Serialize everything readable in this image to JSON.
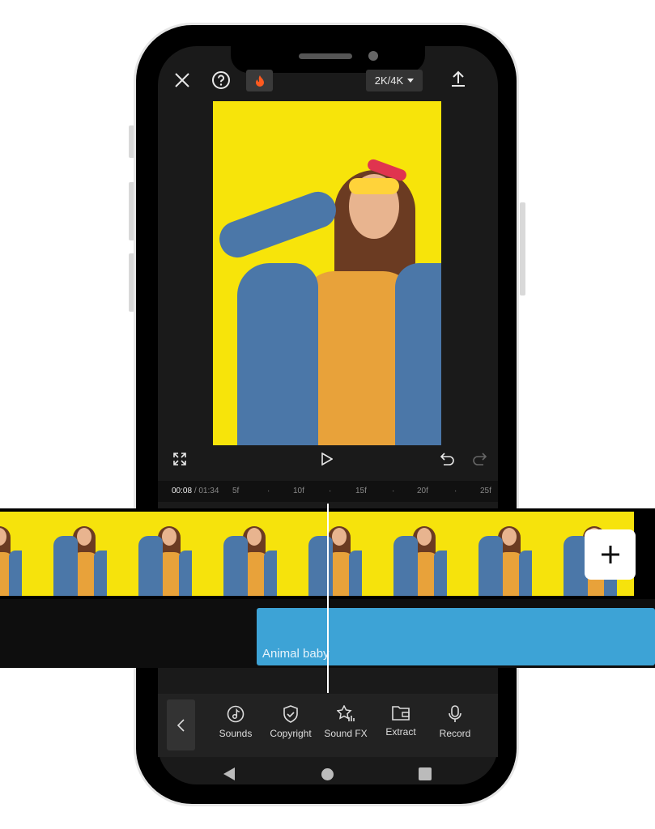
{
  "top_bar": {
    "quality_label": "2K/4K",
    "icons": [
      "close-icon",
      "help-icon",
      "fire-icon",
      "chevron-down-icon",
      "upload-icon"
    ]
  },
  "preview_controls": {
    "icons": [
      "fullscreen-icon",
      "play-icon",
      "undo-icon",
      "redo-icon"
    ]
  },
  "ruler": {
    "current_time": "00:08",
    "separator": "/",
    "total_time": "01:34",
    "ticks": [
      "5f",
      "10f",
      "15f",
      "20f",
      "25f"
    ]
  },
  "timeline": {
    "audio_clip_label": "Animal baby",
    "add_icon": "plus-icon"
  },
  "toolbar": {
    "items": [
      {
        "label": "Sounds",
        "icon": "music-note-icon"
      },
      {
        "label": "Copyright",
        "icon": "shield-check-icon"
      },
      {
        "label": "Sound FX",
        "icon": "star-sound-icon"
      },
      {
        "label": "Extract",
        "icon": "folder-icon"
      },
      {
        "label": "Record",
        "icon": "microphone-icon"
      }
    ]
  },
  "colors": {
    "accent": "#3da3d6",
    "preview_bg": "#f7e40a",
    "fire": "#ff5a1f"
  }
}
